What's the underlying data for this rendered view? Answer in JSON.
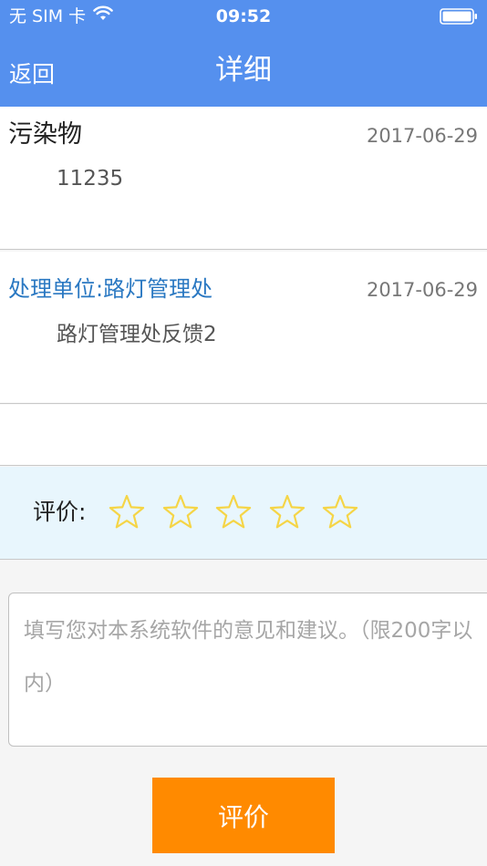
{
  "status_bar": {
    "carrier": "无 SIM 卡",
    "time": "09:52",
    "wifi_icon": "wifi-icon",
    "battery_icon": "battery-icon"
  },
  "nav": {
    "back_label": "返回",
    "title": "详细"
  },
  "records": [
    {
      "title": "污染物",
      "date": "2017-06-29",
      "body": "11235"
    },
    {
      "title": "处理单位:路灯管理处",
      "date": "2017-06-29",
      "body": "路灯管理处反馈2"
    }
  ],
  "rating": {
    "label": "评价:",
    "max_stars": 5,
    "selected": 0,
    "star_icon": "star-outline-icon",
    "star_color": "#f5d547"
  },
  "feedback": {
    "value": "",
    "placeholder": "填写您对本系统软件的意见和建议。（限200字以内）"
  },
  "submit_label": "评价",
  "colors": {
    "header_bg": "#5590ee",
    "accent_blue": "#2a78c2",
    "button_orange": "#ff8a00",
    "rating_bg": "#e8f6fd"
  }
}
